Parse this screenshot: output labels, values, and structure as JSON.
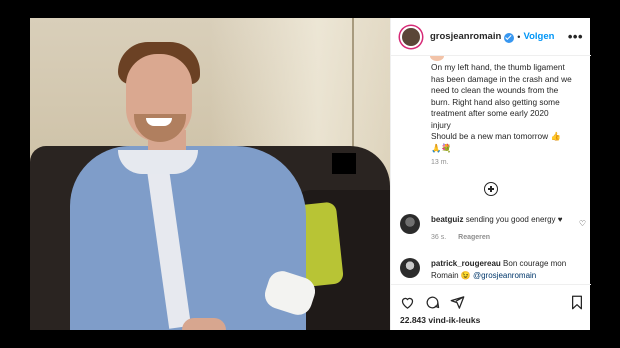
{
  "post": {
    "username": "grosjeanromain",
    "separator": "•",
    "follow_label": "Volgen",
    "more_label": "•••",
    "caption_lines": [
      "On my left hand, the thumb ligament",
      "has been damage in the crash and we",
      "need to clean the wounds from the",
      "burn. Right hand also getting some",
      "treatment after some early 2020",
      "injury",
      "Should be a new man tomorrow 👍",
      "🙏💐"
    ],
    "caption_time": "13 m.",
    "load_more_icon": "plus-circle-icon",
    "likes": "22.843 vind-ik-leuks"
  },
  "comments": [
    {
      "user": "beatguiz",
      "text": "sending you good energy ♥",
      "time": "36 s.",
      "reply_label": "Reageren"
    },
    {
      "user": "patrick_rougereau",
      "text": "Bon courage mon Romain 😉",
      "mention": "@grosjeanromain"
    }
  ],
  "icons": {
    "like": "heart-icon",
    "comment": "comment-icon",
    "share": "paper-plane-icon",
    "save": "bookmark-icon"
  },
  "colors": {
    "accent": "#0095f6",
    "verified": "#3897f0",
    "text": "#262626",
    "muted": "#8e8e8e"
  }
}
